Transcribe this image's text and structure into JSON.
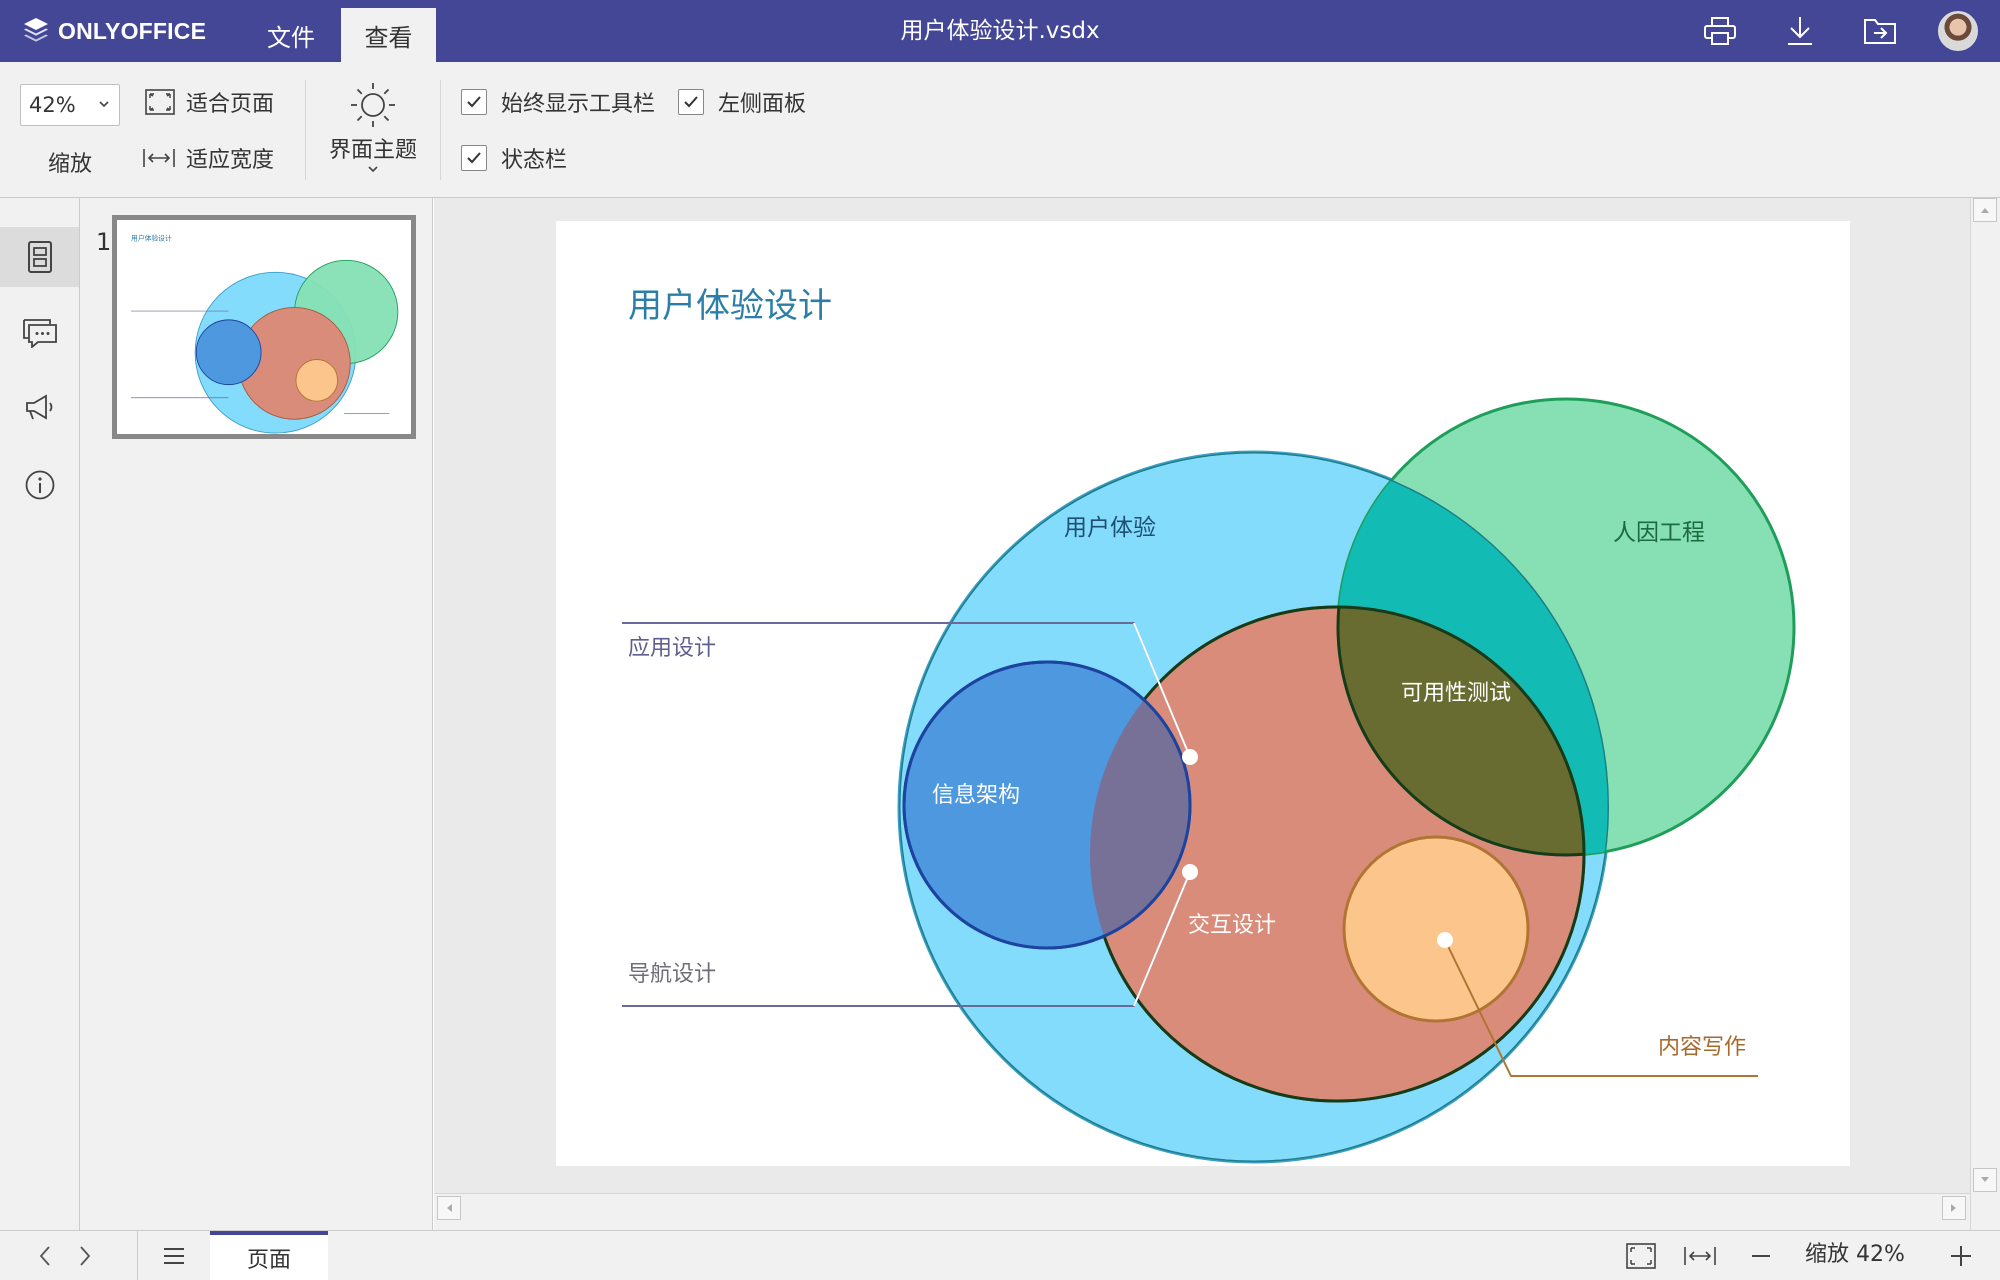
{
  "header": {
    "logo_text": "ONLYOFFICE",
    "tabs": [
      {
        "label": "文件"
      },
      {
        "label": "查看"
      }
    ],
    "doc_title": "用户体验设计.vsdx",
    "bg_color": "#444796"
  },
  "toolbar": {
    "zoom_value": "42%",
    "zoom_label": "缩放",
    "fit_page_label": "适合页面",
    "fit_width_label": "适应宽度",
    "theme_label": "界面主题",
    "checks": {
      "always_toolbar": "始终显示工具栏",
      "left_panel": "左侧面板",
      "status_bar": "状态栏"
    }
  },
  "left_rail": {
    "items": [
      {
        "icon": "pages-icon",
        "active": true
      },
      {
        "icon": "comments-icon",
        "active": false
      },
      {
        "icon": "feedback-icon",
        "active": false
      },
      {
        "icon": "info-icon",
        "active": false
      }
    ]
  },
  "thumbnails": {
    "page_number": "1"
  },
  "diagram": {
    "title": "用户体验设计",
    "labels": {
      "ux": "用户体验",
      "human_factors": "人因工程",
      "usability": "可用性测试",
      "info_arch": "信息架构",
      "interaction": "交互设计",
      "app_design": "应用设计",
      "nav_design": "导航设计",
      "content_writing": "内容写作"
    },
    "colors": {
      "title": "#2a7ea8",
      "ux_fill": "#84dcfd",
      "human_factors_fill": "#86e0b4",
      "interaction_fill": "#d98c7a",
      "info_arch_fill": "#4e98e0",
      "content_fill": "#fbc58c",
      "usability_fill": "#686c31"
    }
  },
  "statusbar": {
    "page_tab": "页面",
    "zoom_text": "缩放 42%"
  }
}
